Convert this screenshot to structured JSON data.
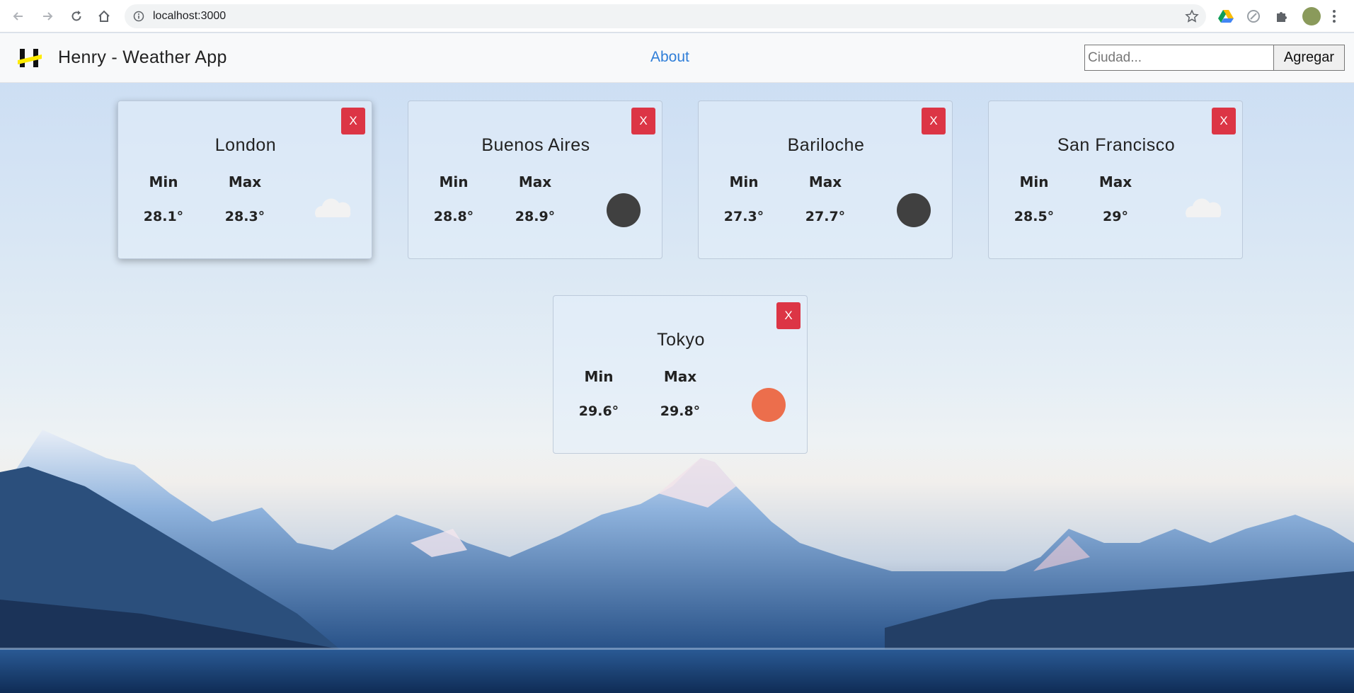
{
  "browser": {
    "url": "localhost:3000",
    "icons": [
      "back-icon",
      "forward-icon",
      "reload-icon",
      "home-icon",
      "info-icon",
      "star-icon",
      "drive-icon",
      "extension-icon",
      "puzzle-icon",
      "profile-avatar",
      "menu-icon"
    ]
  },
  "app": {
    "brand": "Henry - Weather App",
    "nav_about": "About",
    "search_placeholder": "Ciudad...",
    "add_button": "Agregar",
    "close_label": "X",
    "min_label": "Min",
    "max_label": "Max"
  },
  "cards": [
    {
      "city": "London",
      "min": "28.1°",
      "max": "28.3°",
      "icon": "cloud-icon",
      "color": "#f2f2f2"
    },
    {
      "city": "Buenos Aires",
      "min": "28.8°",
      "max": "28.9°",
      "icon": "dark-circle-icon",
      "color": "#404040"
    },
    {
      "city": "Bariloche",
      "min": "27.3°",
      "max": "27.7°",
      "icon": "dark-circle-icon",
      "color": "#404040"
    },
    {
      "city": "San Francisco",
      "min": "28.5°",
      "max": "29°",
      "icon": "cloud-icon",
      "color": "#f2f2f2"
    },
    {
      "city": "Tokyo",
      "min": "29.6°",
      "max": "29.8°",
      "icon": "sun-icon",
      "color": "#ec6e4c"
    }
  ],
  "colors": {
    "accent_link": "#2f7ed8",
    "close_button": "#dc3545",
    "navbar_bg": "#f8f9fa"
  }
}
